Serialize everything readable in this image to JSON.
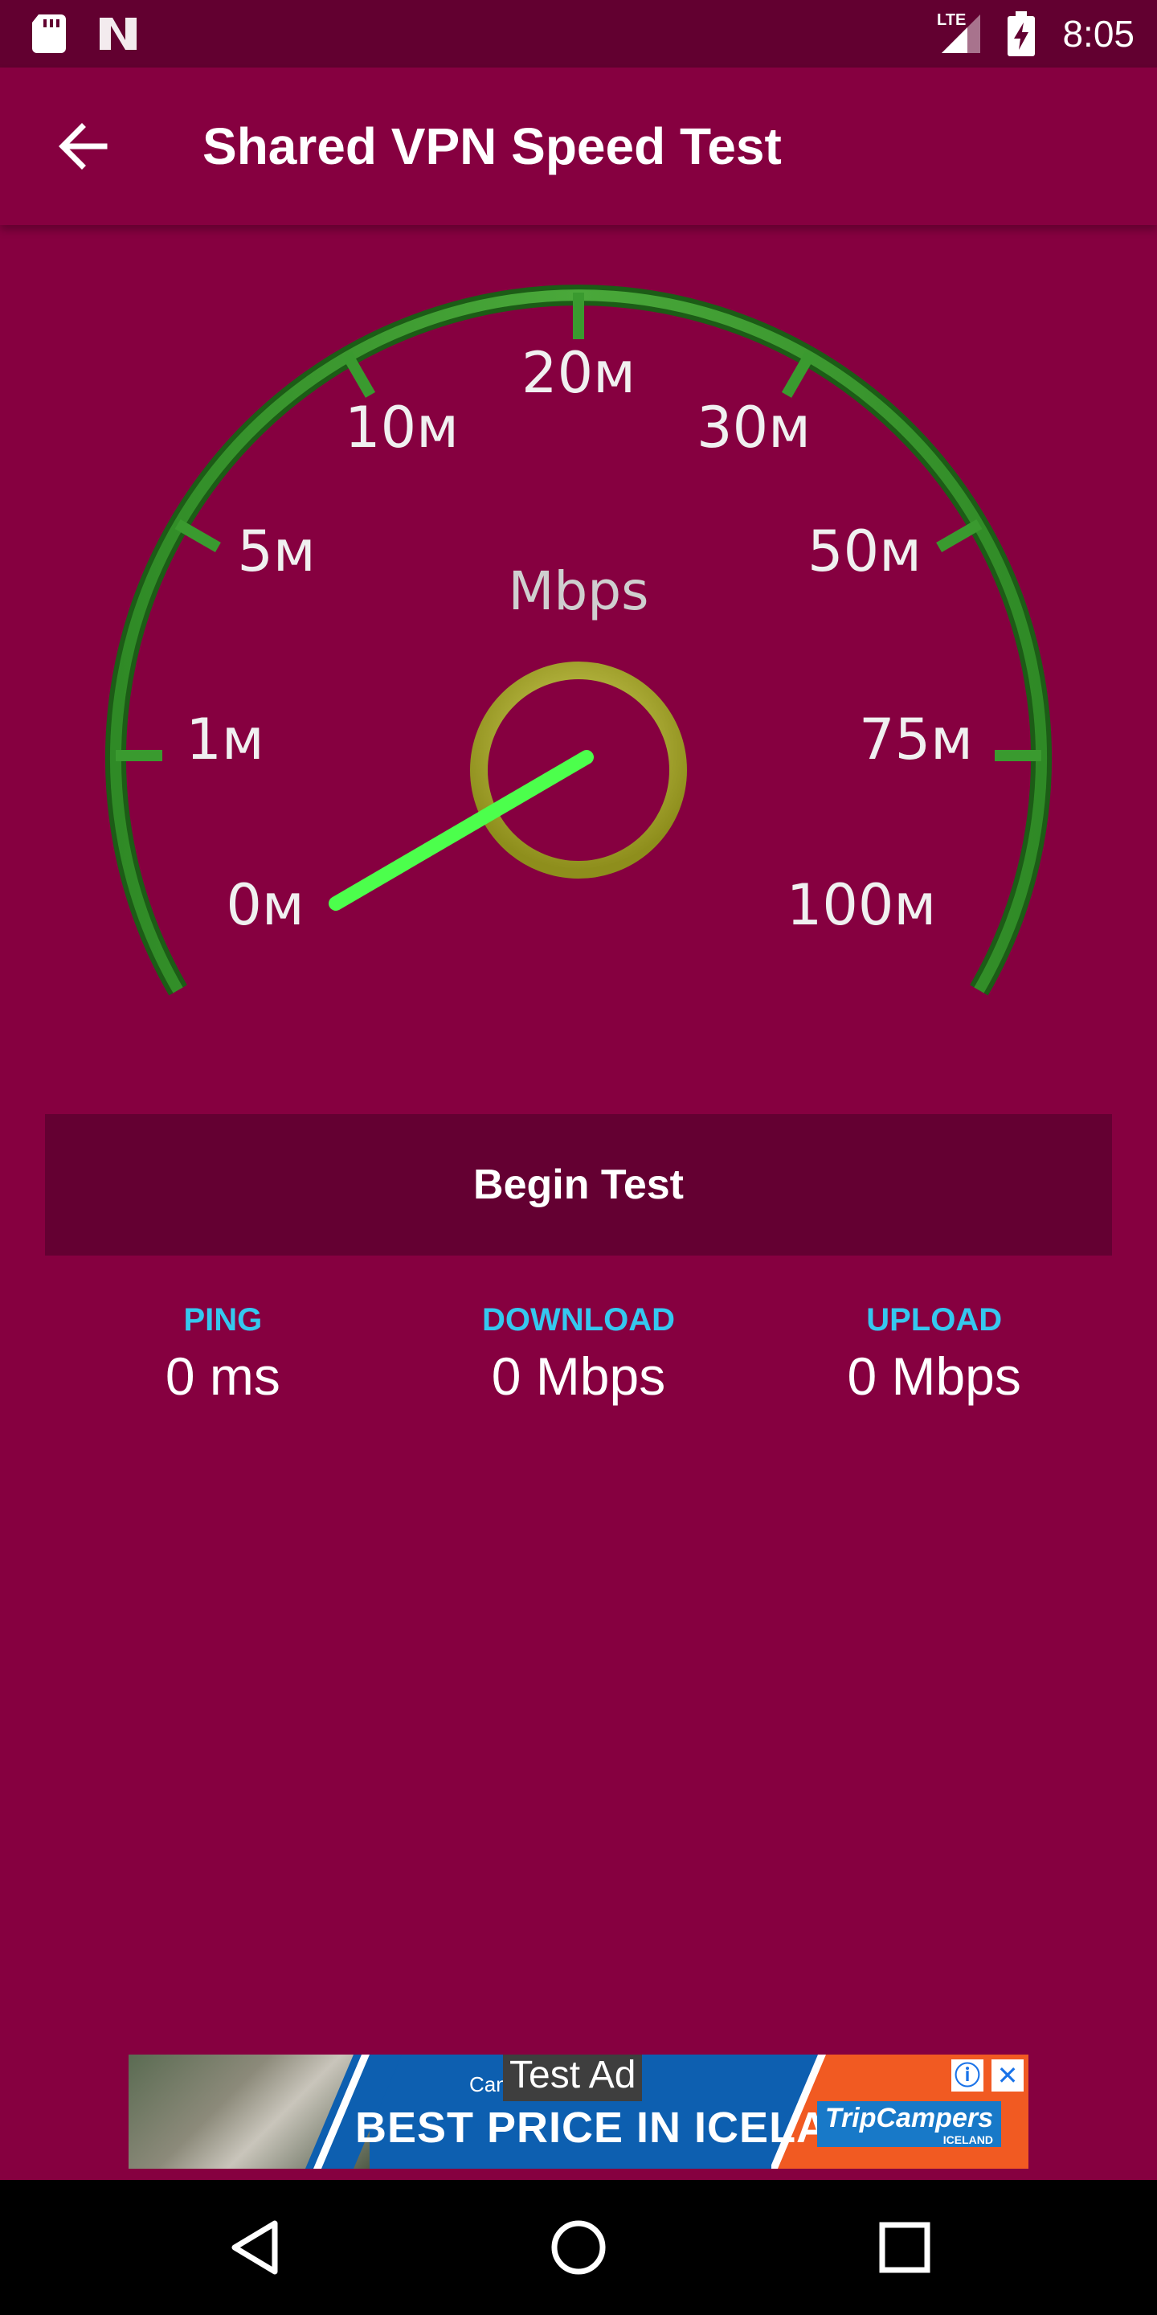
{
  "status_bar": {
    "time": "8:05",
    "network": "LTE",
    "icons": [
      "sd-card-icon",
      "notification-n-icon",
      "lte-signal-icon",
      "battery-charging-icon"
    ]
  },
  "app_bar": {
    "title": "Shared VPN Speed Test",
    "back_icon": "arrow-back-icon"
  },
  "gauge": {
    "unit_label": "Mbps",
    "tick_labels": [
      "0м",
      "1м",
      "5м",
      "10м",
      "20м",
      "30м",
      "50м",
      "75м",
      "100м"
    ],
    "needle_value": 0,
    "colors": {
      "arc": "#3a9a2f",
      "needle": "#4cff4c",
      "hub": "#b8b830"
    }
  },
  "actions": {
    "begin_label": "Begin Test"
  },
  "stats": {
    "ping": {
      "label": "PING",
      "value": "0 ms"
    },
    "download": {
      "label": "DOWNLOAD",
      "value": "0 Mbps"
    },
    "upload": {
      "label": "UPLOAD",
      "value": "0 Mbps"
    }
  },
  "ad": {
    "tag": "Test Ad",
    "small_text": "Can",
    "headline": "BEST PRICE IN ICELAND",
    "brand": "TripCampers",
    "brand_sub": "ICELAND"
  },
  "nav_bar": {
    "icons": [
      "back-triangle-icon",
      "home-circle-icon",
      "recents-square-icon"
    ]
  },
  "colors": {
    "background": "#860040",
    "status_bar": "#620030",
    "button": "#640032",
    "stat_label": "#35c8ef"
  }
}
